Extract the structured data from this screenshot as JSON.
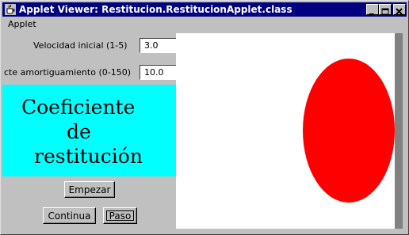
{
  "window": {
    "title": "Applet Viewer: Restitucion.RestitucionApplet.class",
    "icon": "java-cup-icon",
    "controls": [
      "minimize-icon",
      "maximize-icon",
      "close-icon"
    ]
  },
  "menu": {
    "items": [
      "Applet"
    ]
  },
  "inputs": {
    "velocidad": {
      "label": "Velocidad inicial (1-5)",
      "value": "3.0"
    },
    "cte": {
      "label": "cte amortiguamiento (0-150)",
      "value": "10.0"
    }
  },
  "banner": {
    "lines": [
      "Coeficiente",
      "de",
      "restitución"
    ],
    "background": "#00ffff"
  },
  "buttons": {
    "empezar": "Empezar",
    "continua": "Continua",
    "paso": "Paso"
  },
  "canvas": {
    "background": "#ffffff",
    "ball_color": "#ff0000"
  }
}
